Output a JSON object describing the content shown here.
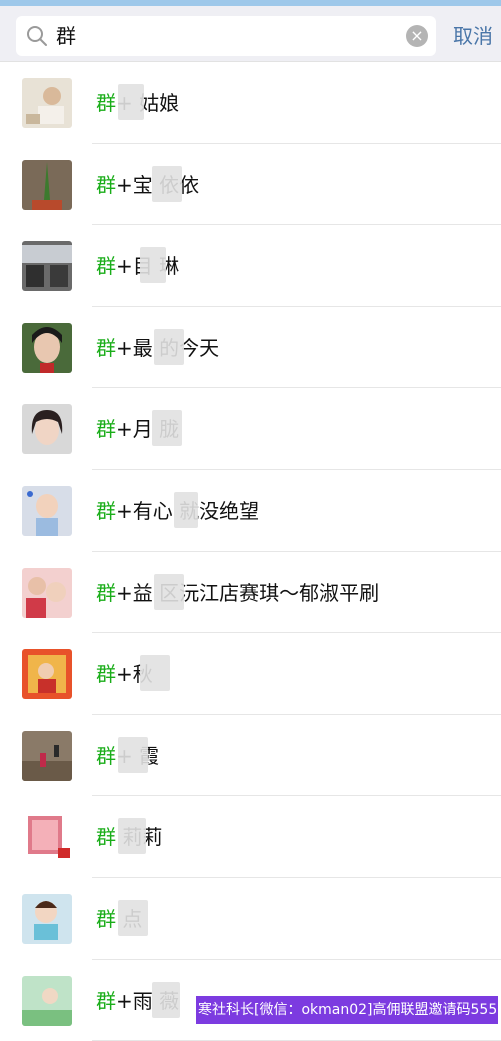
{
  "search": {
    "query": "群",
    "cancel_label": "取消"
  },
  "keyword": "群",
  "contacts": [
    {
      "name": "+ 姑娘",
      "avatar": "baby-photo"
    },
    {
      "name": "+宝 依依",
      "avatar": "aloe-plant"
    },
    {
      "name": "+目 琳",
      "avatar": "bus-interior"
    },
    {
      "name": "+最 的今天",
      "avatar": "woman-portrait"
    },
    {
      "name": "+月 胧",
      "avatar": "girl-portrait"
    },
    {
      "name": "+有心 就没绝望",
      "avatar": "child-photo"
    },
    {
      "name": "+益 区沅江店赛琪～郁淑平刷",
      "avatar": "mother-child"
    },
    {
      "name": "+秋",
      "avatar": "toddler-red"
    },
    {
      "name": "+ 霞",
      "avatar": "hiking-photo"
    },
    {
      "name": " 莉莉",
      "avatar": "kid-sign"
    },
    {
      "name": " 点",
      "avatar": "baby-cartoon"
    },
    {
      "name": "+雨 薇",
      "avatar": "cartoon-scene"
    }
  ],
  "watermark": "寒社科长[微信：okman02]高佣联盟邀请码555666"
}
